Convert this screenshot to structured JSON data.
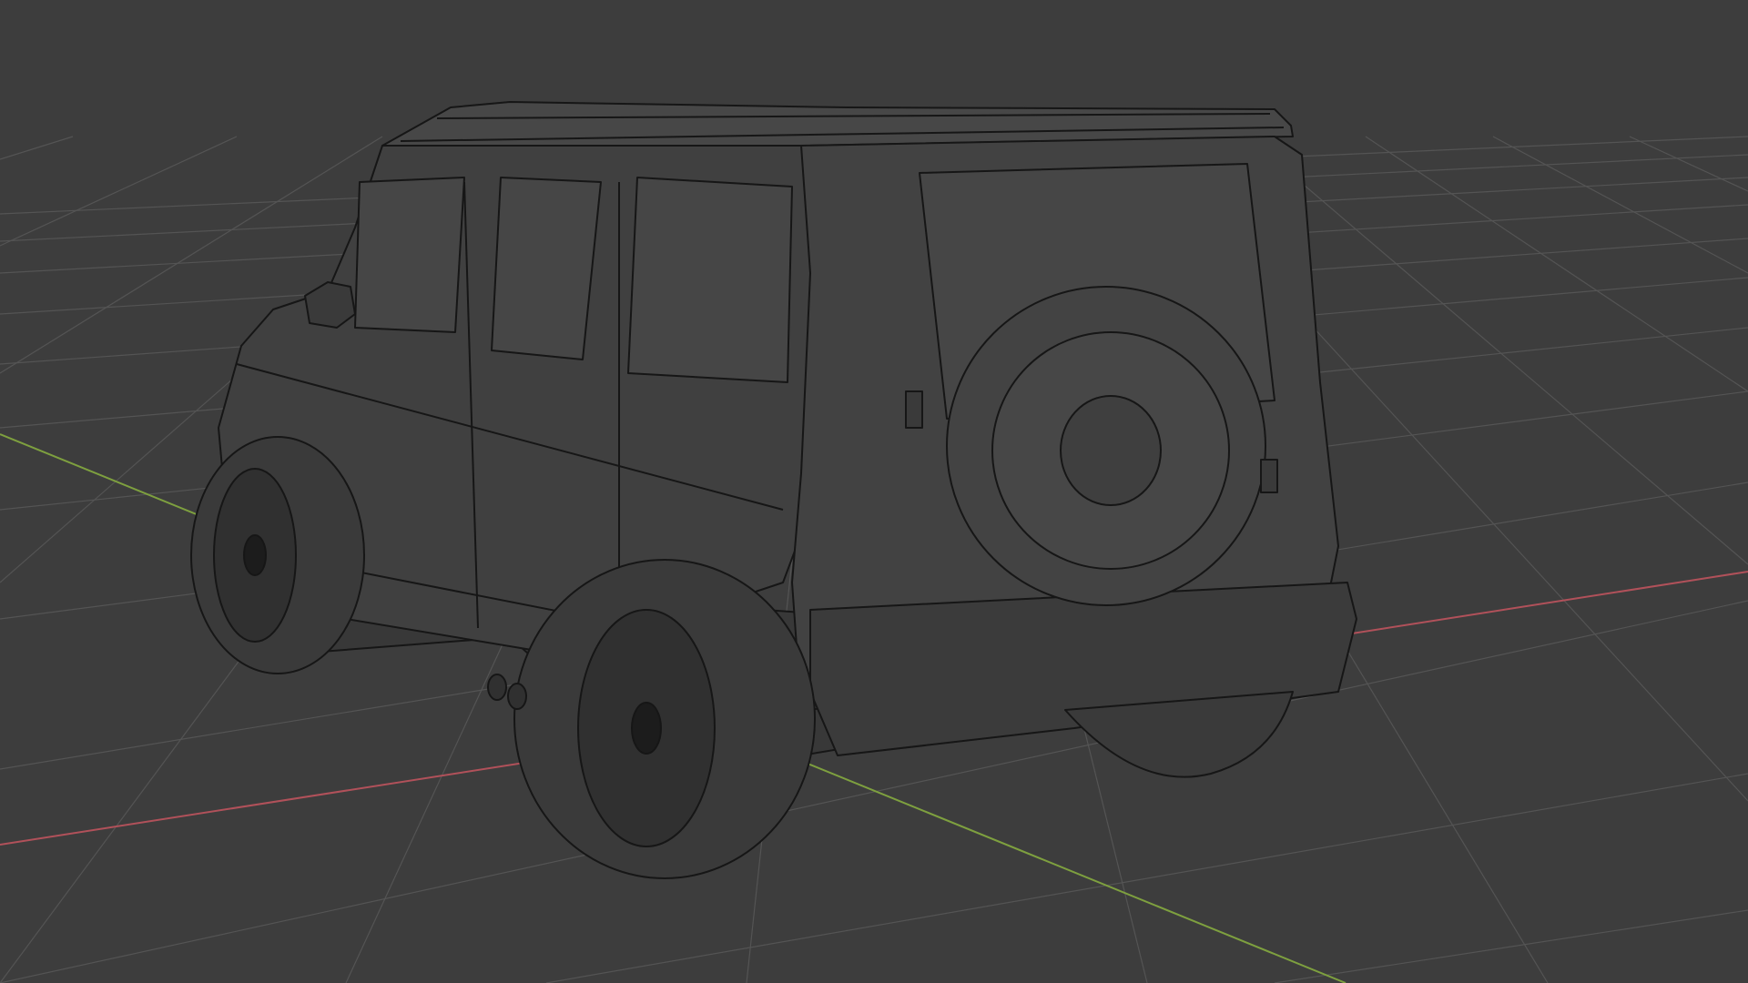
{
  "app": {
    "kind": "3d-viewport"
  },
  "viewport": {
    "background_color": "#3d3d3d",
    "shading_mode": "wireframe",
    "grid": {
      "visible": true,
      "line_color": "#545454"
    },
    "axes": {
      "x_axis_color": "#b1515a",
      "y_axis_color": "#7ea03f"
    },
    "object": {
      "name_icon": "suv-wireframe-model",
      "wire_color": "#161616",
      "fill_color": "#404040"
    }
  }
}
